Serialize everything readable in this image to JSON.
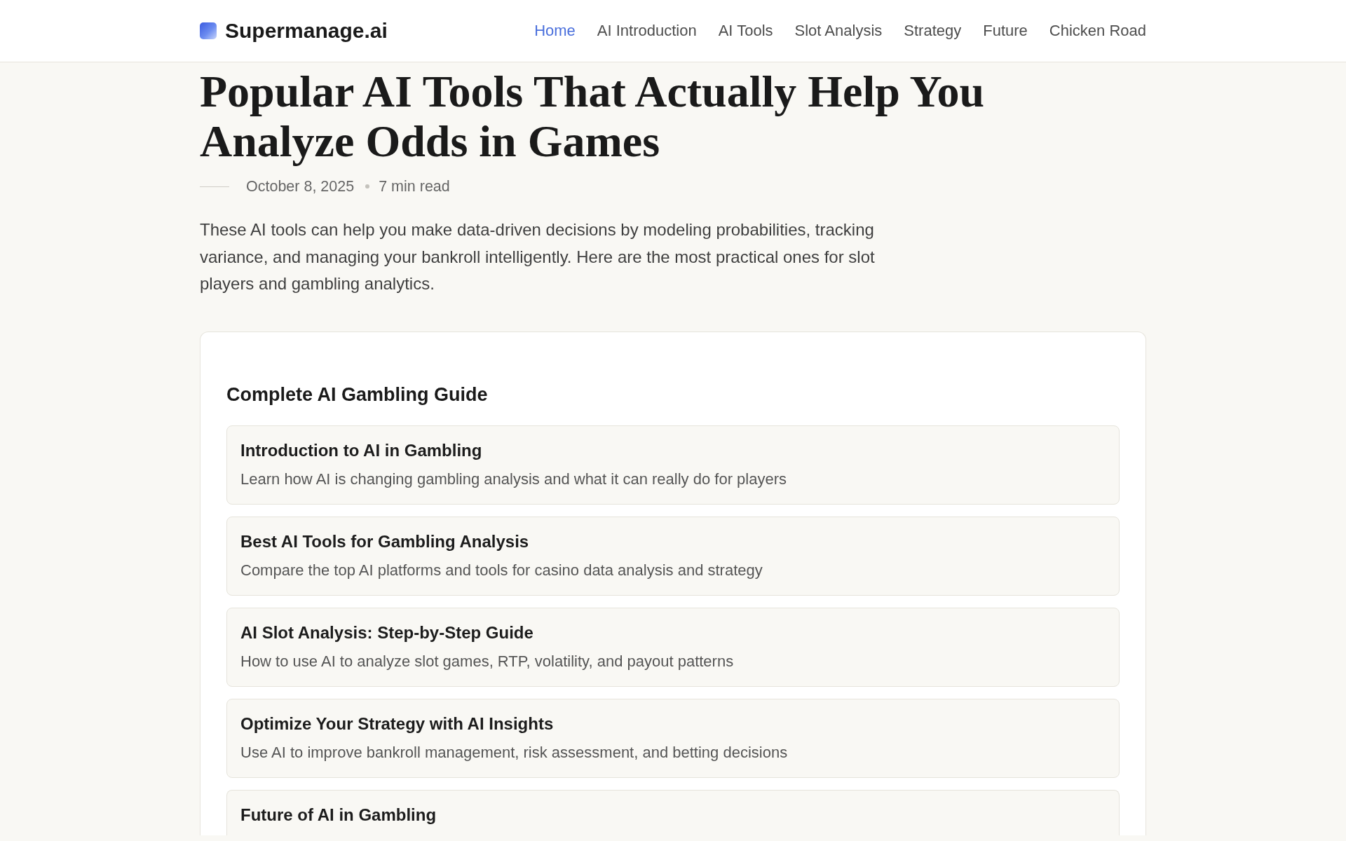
{
  "header": {
    "logo": "Supermanage.ai",
    "nav": [
      {
        "label": "Home",
        "selected": true
      },
      {
        "label": "AI Introduction",
        "selected": false
      },
      {
        "label": "AI Tools",
        "selected": false
      },
      {
        "label": "Slot Analysis",
        "selected": false
      },
      {
        "label": "Strategy",
        "selected": false
      },
      {
        "label": "Future",
        "selected": false
      },
      {
        "label": "Chicken Road",
        "selected": false
      }
    ]
  },
  "article": {
    "title": "Popular AI Tools That Actually Help You Analyze Odds in Games",
    "date": "October 8, 2025",
    "read_time": "7 min read",
    "intro": "These AI tools can help you make data-driven decisions by modeling probabilities, tracking variance, and managing your bankroll intelligently. Here are the most practical ones for slot players and gambling analytics."
  },
  "guide": {
    "heading": "Complete AI Gambling Guide",
    "items": [
      {
        "title": "Introduction to AI in Gambling",
        "description": "Learn how AI is changing gambling analysis and what it can really do for players"
      },
      {
        "title": "Best AI Tools for Gambling Analysis",
        "description": "Compare the top AI platforms and tools for casino data analysis and strategy"
      },
      {
        "title": "AI Slot Analysis: Step-by-Step Guide",
        "description": "How to use AI to analyze slot games, RTP, volatility, and payout patterns"
      },
      {
        "title": "Optimize Your Strategy with AI Insights",
        "description": "Use AI to improve bankroll management, risk assessment, and betting decisions"
      },
      {
        "title": "Future of AI in Gambling"
      }
    ]
  }
}
